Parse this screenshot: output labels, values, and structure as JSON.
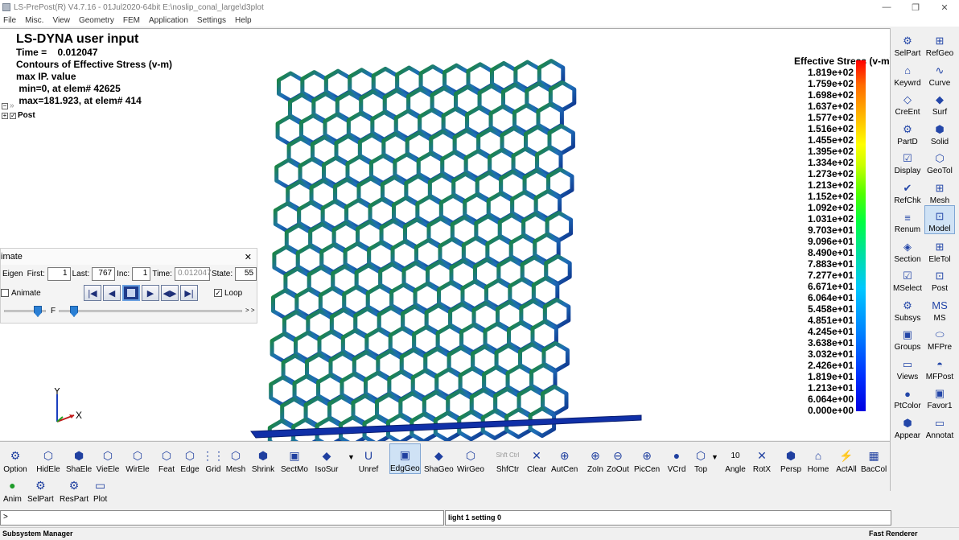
{
  "window": {
    "title": "LS-PrePost(R) V4.7.16 - 01Jul2020-64bit E:\\noslip_conal_large\\d3plot",
    "min": "—",
    "max": "❐",
    "close": "✕"
  },
  "menu": [
    "File",
    "Misc.",
    "View",
    "Geometry",
    "FEM",
    "Application",
    "Settings",
    "Help"
  ],
  "info": {
    "line1": "LS-DYNA user input",
    "line2": "Time =    0.012047",
    "line3": "Contours of Effective Stress (v-m)",
    "line4": "max IP. value",
    "line5": " min=0, at elem# 42625",
    "line6": " max=181.923, at elem# 414"
  },
  "tree": {
    "post_label": "Post"
  },
  "anim_panel": {
    "title": "imate",
    "close": "✕",
    "eigen": "Eigen",
    "first_label": "First:",
    "first": "1",
    "last_label": "Last:",
    "last": "767",
    "inc_label": "Inc:",
    "inc": "1",
    "time_label": "Time:",
    "time": "0.012047",
    "state_label": "State:",
    "state": "55",
    "animate_label": "Animate",
    "loop_label": "Loop",
    "f_label": "F",
    "more": "> >"
  },
  "axis": {
    "y": "Y",
    "x": "X"
  },
  "legend": {
    "title": "Effective Stress (v-m)",
    "labels": [
      "1.819e+02",
      "1.759e+02",
      "1.698e+02",
      "1.637e+02",
      "1.577e+02",
      "1.516e+02",
      "1.455e+02",
      "1.395e+02",
      "1.334e+02",
      "1.273e+02",
      "1.213e+02",
      "1.152e+02",
      "1.092e+02",
      "1.031e+02",
      "9.703e+01",
      "9.096e+01",
      "8.490e+01",
      "7.883e+01",
      "7.277e+01",
      "6.671e+01",
      "6.064e+01",
      "5.458e+01",
      "4.851e+01",
      "4.245e+01",
      "3.638e+01",
      "3.032e+01",
      "2.426e+01",
      "1.819e+01",
      "1.213e+01",
      "6.064e+00",
      "0.000e+00"
    ]
  },
  "right_toolbar": [
    {
      "label": "SelPart",
      "icon": "selpart-icon"
    },
    {
      "label": "RefGeo",
      "icon": "refgeo-icon"
    },
    {
      "label": "Keywrd",
      "icon": "keyword-icon"
    },
    {
      "label": "Curve",
      "icon": "curve-icon"
    },
    {
      "label": "CreEnt",
      "icon": "create-entity-icon"
    },
    {
      "label": "Surf",
      "icon": "surface-icon"
    },
    {
      "label": "PartD",
      "icon": "part-data-icon"
    },
    {
      "label": "Solid",
      "icon": "solid-icon"
    },
    {
      "label": "Display",
      "icon": "display-icon"
    },
    {
      "label": "GeoTol",
      "icon": "geotol-icon"
    },
    {
      "label": "RefChk",
      "icon": "refchk-icon"
    },
    {
      "label": "Mesh",
      "icon": "mesh-icon"
    },
    {
      "label": "Renum",
      "icon": "renum-icon"
    },
    {
      "label": "Model",
      "icon": "model-icon"
    },
    {
      "label": "Section",
      "icon": "section-icon"
    },
    {
      "label": "EleTol",
      "icon": "eletol-icon"
    },
    {
      "label": "MSelect",
      "icon": "mselect-icon"
    },
    {
      "label": "Post",
      "icon": "post-icon"
    },
    {
      "label": "Subsys",
      "icon": "subsys-icon"
    },
    {
      "label": "MS",
      "icon": "ms-icon"
    },
    {
      "label": "Groups",
      "icon": "groups-icon"
    },
    {
      "label": "MFPre",
      "icon": "mfpre-icon"
    },
    {
      "label": "Views",
      "icon": "views-icon"
    },
    {
      "label": "MFPost",
      "icon": "mfpost-icon"
    },
    {
      "label": "PtColor",
      "icon": "ptcolor-icon"
    },
    {
      "label": "Favor1",
      "icon": "favorite-icon"
    },
    {
      "label": "Appear",
      "icon": "appear-icon"
    },
    {
      "label": "Annotat",
      "icon": "annotate-icon"
    }
  ],
  "bottom_toolbar": [
    {
      "label": "Option",
      "icon": "option-icon"
    },
    {
      "label": "HidEle",
      "icon": "hide-element-icon"
    },
    {
      "label": "ShaEle",
      "icon": "shade-element-icon"
    },
    {
      "label": "VieEle",
      "icon": "view-element-icon"
    },
    {
      "label": "WirEle",
      "icon": "wire-element-icon"
    },
    {
      "label": "Feat",
      "icon": "feature-icon"
    },
    {
      "label": "Edge",
      "icon": "edge-icon"
    },
    {
      "label": "Grid",
      "icon": "grid-icon"
    },
    {
      "label": "Mesh",
      "icon": "mesh-icon"
    },
    {
      "label": "Shrink",
      "icon": "shrink-icon"
    },
    {
      "label": "SectMo",
      "icon": "section-mode-icon"
    },
    {
      "label": "IsoSur",
      "icon": "isosurface-icon"
    },
    {
      "label": "Unref",
      "icon": "unref-icon"
    },
    {
      "label": "EdgGeo",
      "icon": "edge-geometry-icon"
    },
    {
      "label": "ShaGeo",
      "icon": "shade-geometry-icon"
    },
    {
      "label": "WirGeo",
      "icon": "wire-geometry-icon"
    },
    {
      "label": "ShfCtr",
      "icon": "shift-ctrl-icon"
    },
    {
      "label": "Clear",
      "icon": "clear-icon"
    },
    {
      "label": "AutCen",
      "icon": "auto-center-icon"
    },
    {
      "label": "ZoIn",
      "icon": "zoom-in-icon"
    },
    {
      "label": "ZoOut",
      "icon": "zoom-out-icon"
    },
    {
      "label": "PicCen",
      "icon": "pick-center-icon"
    },
    {
      "label": "VCrd",
      "icon": "view-coord-icon"
    },
    {
      "label": "Top",
      "icon": "top-view-icon"
    },
    {
      "label": "Angle",
      "icon": "angle-icon"
    },
    {
      "label": "RotX",
      "icon": "rotate-x-icon"
    },
    {
      "label": "Persp",
      "icon": "perspective-icon"
    },
    {
      "label": "Home",
      "icon": "home-icon"
    },
    {
      "label": "ActAll",
      "icon": "activate-all-icon"
    },
    {
      "label": "BacCol",
      "icon": "background-color-icon"
    }
  ],
  "angle_value": "10",
  "shfctr_text": "Shft Ctrl",
  "bottom_toolbar2": [
    {
      "label": "Anim",
      "icon": "anim-icon"
    },
    {
      "label": "SelPart",
      "icon": "selpart-icon"
    },
    {
      "label": "ResPart",
      "icon": "respart-icon"
    },
    {
      "label": "Plot",
      "icon": "plot-icon"
    }
  ],
  "command": {
    "prompt": ">",
    "output": "light 1 setting 0"
  },
  "status": {
    "left": "Subsystem Manager",
    "right": "Fast Renderer"
  }
}
